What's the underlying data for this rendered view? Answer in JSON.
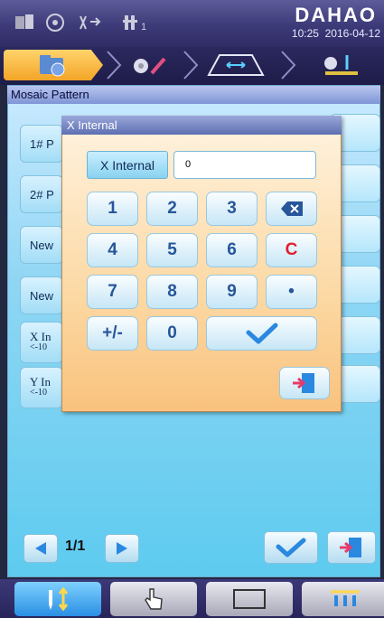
{
  "status_bar": {
    "brand": "DAHAO",
    "time": "10:25",
    "date": "2016-04-12",
    "counter": "1",
    "icons": [
      "machine-status-icon",
      "spindle-icon",
      "needle-icon",
      "head-icon"
    ]
  },
  "step_bar": {
    "steps": [
      "folder-pattern-icon",
      "edit-pattern-icon",
      "frame-move-icon",
      "embroider-start-icon"
    ],
    "active_step": 0
  },
  "panel": {
    "title": "Mosaic Pattern",
    "rows": [
      {
        "label": "1# P",
        "sub": ""
      },
      {
        "label": "2# P",
        "sub": ""
      },
      {
        "label": "New",
        "sub": ""
      },
      {
        "label": "New",
        "sub": ""
      },
      {
        "label": "X In",
        "sub": "<-10"
      },
      {
        "label": "Y In",
        "sub": "<-10"
      }
    ],
    "page_indicator": "1/1"
  },
  "dialog": {
    "title": "X Internal",
    "field_label": "X Internal",
    "field_value": "0",
    "keys": [
      "1",
      "2",
      "3",
      "backspace",
      "4",
      "5",
      "6",
      "C",
      "7",
      "8",
      "9",
      "•",
      "+/-",
      "0",
      "enter"
    ]
  },
  "bottom_tabs": {
    "tabs": [
      "needle-tab-icon",
      "manual-tab-icon",
      "frame-tab-icon",
      "multi-needle-tab-icon"
    ],
    "active": 0
  },
  "colors": {
    "accent": "#f3a527",
    "panel_bg": "#8fd6f4",
    "dialog_bg": "#fcd9a4",
    "key_text": "#27569a",
    "clear_key": "#e0202e",
    "confirm_blue": "#2a88e0",
    "exit_pink": "#e83a6a"
  }
}
